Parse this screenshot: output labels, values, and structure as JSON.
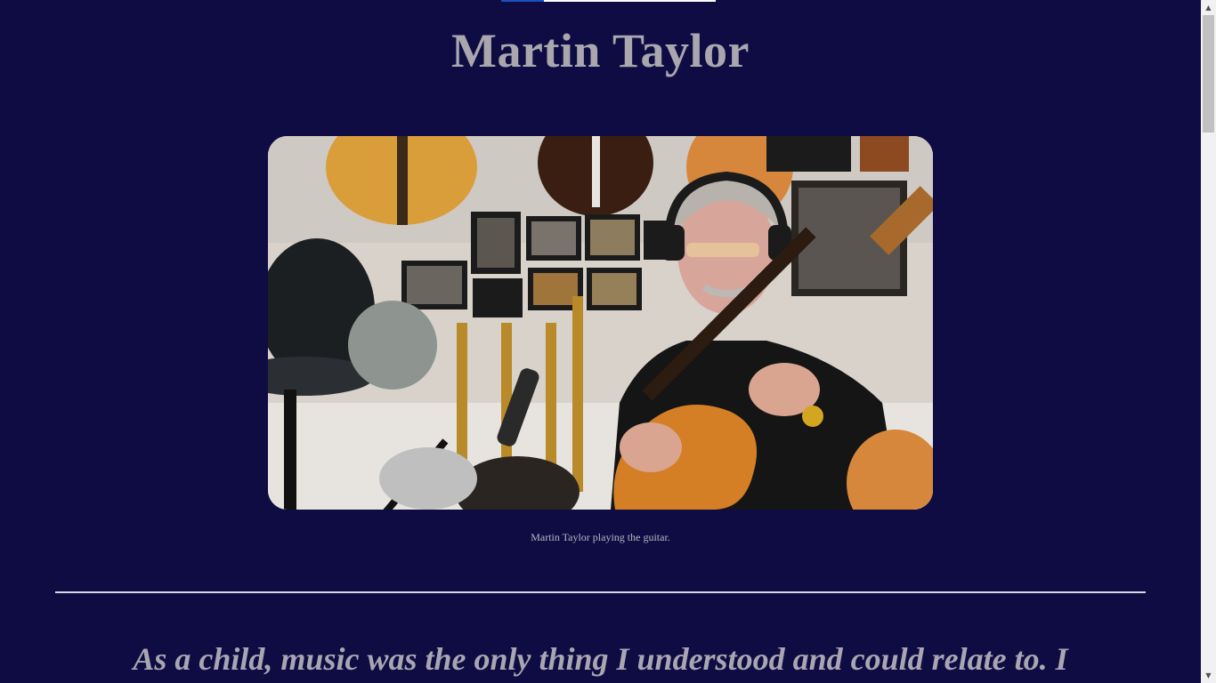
{
  "page": {
    "title": "Martin Taylor",
    "image_alt": "Martin Taylor playing the guitar in a studio",
    "caption": "Martin Taylor playing the guitar.",
    "quote": "As a child, music was the only thing I understood and could relate to. I"
  },
  "colors": {
    "background": "#0f0c44",
    "title": "#a9a6ae",
    "divider": "#d8d6e2"
  },
  "scrollbar": {
    "up_icon": "triangle-up",
    "down_icon": "triangle-down"
  }
}
